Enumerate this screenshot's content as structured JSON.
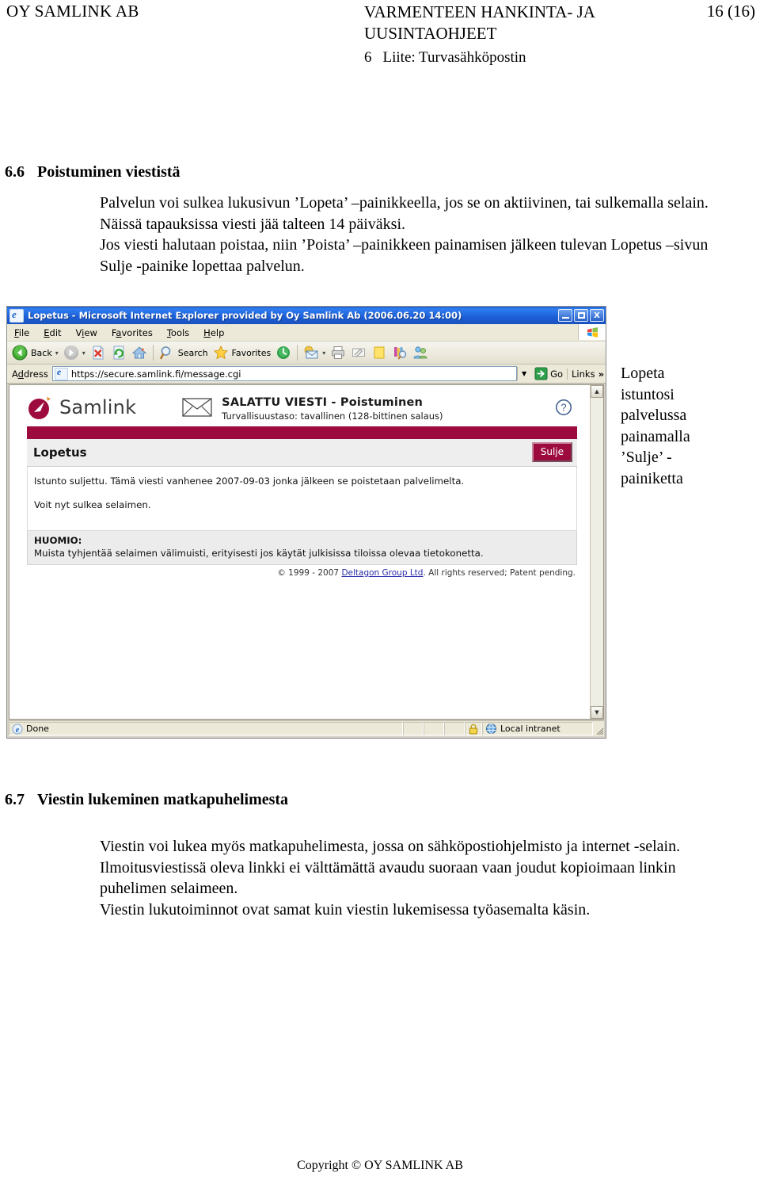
{
  "header": {
    "company": "OY SAMLINK AB",
    "doc_title_line1": "VARMENTEEN HANKINTA- JA",
    "doc_title_line2": "UUSINTAOHJEET",
    "appendix_num": "6",
    "appendix_title": "Liite: Turvasähköpostin",
    "page_number": "16 (16)"
  },
  "section_66": {
    "number": "6.6",
    "title": "Poistuminen viestistä",
    "paragraph1": "Palvelun voi sulkea lukusivun ’Lopeta’ –painikkeella, jos se on aktiivinen, tai sulkemalla selain. Näissä tapauksissa viesti jää talteen 14 päiväksi.",
    "paragraph2": "Jos viesti halutaan poistaa, niin ’Poista’ –painikkeen painamisen jälkeen tulevan Lopetus –sivun Sulje -painike lopettaa palvelun."
  },
  "browser": {
    "title": "Lopetus - Microsoft Internet Explorer provided by Oy Samlink Ab (2006.06.20 14:00)",
    "window_buttons": {
      "minimize": "minimize-icon",
      "maximize": "maximize-icon",
      "close": "X"
    },
    "menus": [
      "File",
      "Edit",
      "View",
      "Favorites",
      "Tools",
      "Help"
    ],
    "toolbar": {
      "back_label": "Back",
      "forward_label": "",
      "stop_label": "",
      "refresh_label": "",
      "home_label": "",
      "search_label": "Search",
      "favorites_label": "Favorites",
      "history_label": "",
      "mail_label": "",
      "print_label": "",
      "edit_label": "",
      "discuss_label": "",
      "research_label": "",
      "messenger_label": ""
    },
    "address": {
      "label": "Address",
      "value": "https://secure.samlink.fi/message.cgi",
      "go_label": "Go",
      "links_label": "Links",
      "chevron": "»"
    },
    "status": {
      "done": "Done",
      "zone": "Local intranet"
    }
  },
  "securemail": {
    "brand": "Samlink",
    "message_title": "SALATTU VIESTI - Poistuminen",
    "security_level": "Turvallisuustaso: tavallinen (128-bittinen salaus)",
    "help_icon": "question-mark-icon",
    "page_title": "Lopetus",
    "close_button": "Sulje",
    "body_line1": "Istunto suljettu. Tämä viesti vanhenee 2007-09-03 jonka jälkeen se poistetaan palvelimelta.",
    "body_line2": "Voit nyt sulkea selaimen.",
    "notice_heading": "HUOMIO:",
    "notice_text": "Muista tyhjentää selaimen välimuisti, erityisesti jos käytät julkisissa tiloissa olevaa tietokonetta.",
    "copyright_prefix": "© 1999 - 2007 ",
    "copyright_link": "Deltagon Group Ltd",
    "copyright_suffix": ". All rights reserved; Patent pending.",
    "accent_color": "#9d0b3e"
  },
  "callout": {
    "line1": "Lopeta",
    "line2": "istuntosi",
    "line3": "palvelussa",
    "line4": "painamalla",
    "line5": "’Sulje’ -",
    "line6": "painiketta"
  },
  "section_67": {
    "number": "6.7",
    "title": "Viestin lukeminen matkapuhelimesta",
    "paragraph1": "Viestin voi lukea myös matkapuhelimesta, jossa on sähköpostiohjelmisto ja internet -selain. Ilmoitusviestissä oleva linkki ei välttämättä avaudu suoraan vaan joudut kopioimaan linkin puhelimen selaimeen.",
    "paragraph2": "Viestin lukutoiminnot ovat samat kuin viestin lukemisessa työasemalta käsin."
  },
  "footer": {
    "copyright": "Copyright © OY SAMLINK AB"
  }
}
